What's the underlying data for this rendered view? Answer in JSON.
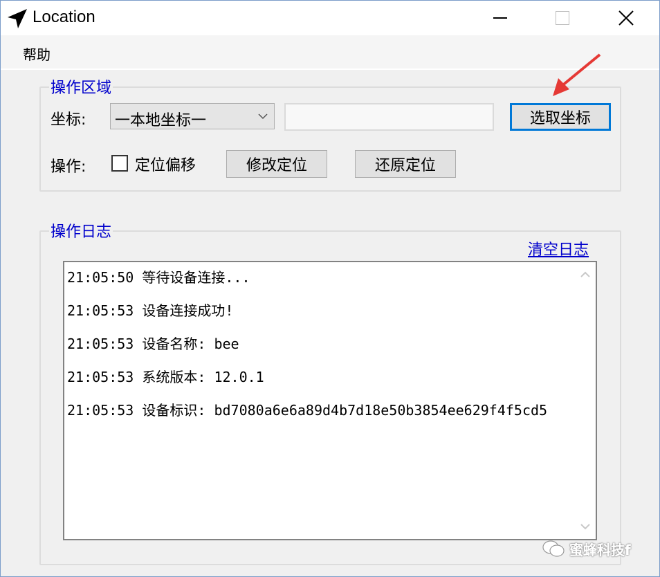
{
  "window": {
    "title": "Location"
  },
  "menu": {
    "help": "帮助"
  },
  "operation_area": {
    "title": "操作区域",
    "coordinate_label": "坐标:",
    "coordinate_select_value": "一本地坐标一",
    "coordinate_input_value": "",
    "pick_button": "选取坐标",
    "operation_label": "操作:",
    "offset_checkbox_label": "定位偏移",
    "offset_checked": false,
    "modify_button": "修改定位",
    "restore_button": "还原定位"
  },
  "log_area": {
    "title": "操作日志",
    "clear_link": "清空日志",
    "lines": [
      "21:05:50 等待设备连接...",
      "21:05:53 设备连接成功!",
      "21:05:53 设备名称: bee",
      "21:05:53 系统版本: 12.0.1",
      "21:05:53 设备标识: bd7080a6e6a89d4b7d18e50b3854ee629f4f5cd5"
    ]
  },
  "watermark": {
    "text": "蜜蜂科技f"
  },
  "colors": {
    "group_title": "#0000cc",
    "annotation_arrow": "#e53935",
    "focus_border": "#0078d7"
  },
  "icons": {
    "app": "navigation-arrow-icon",
    "close": "close-icon",
    "dropdown": "chevron-down-icon"
  }
}
